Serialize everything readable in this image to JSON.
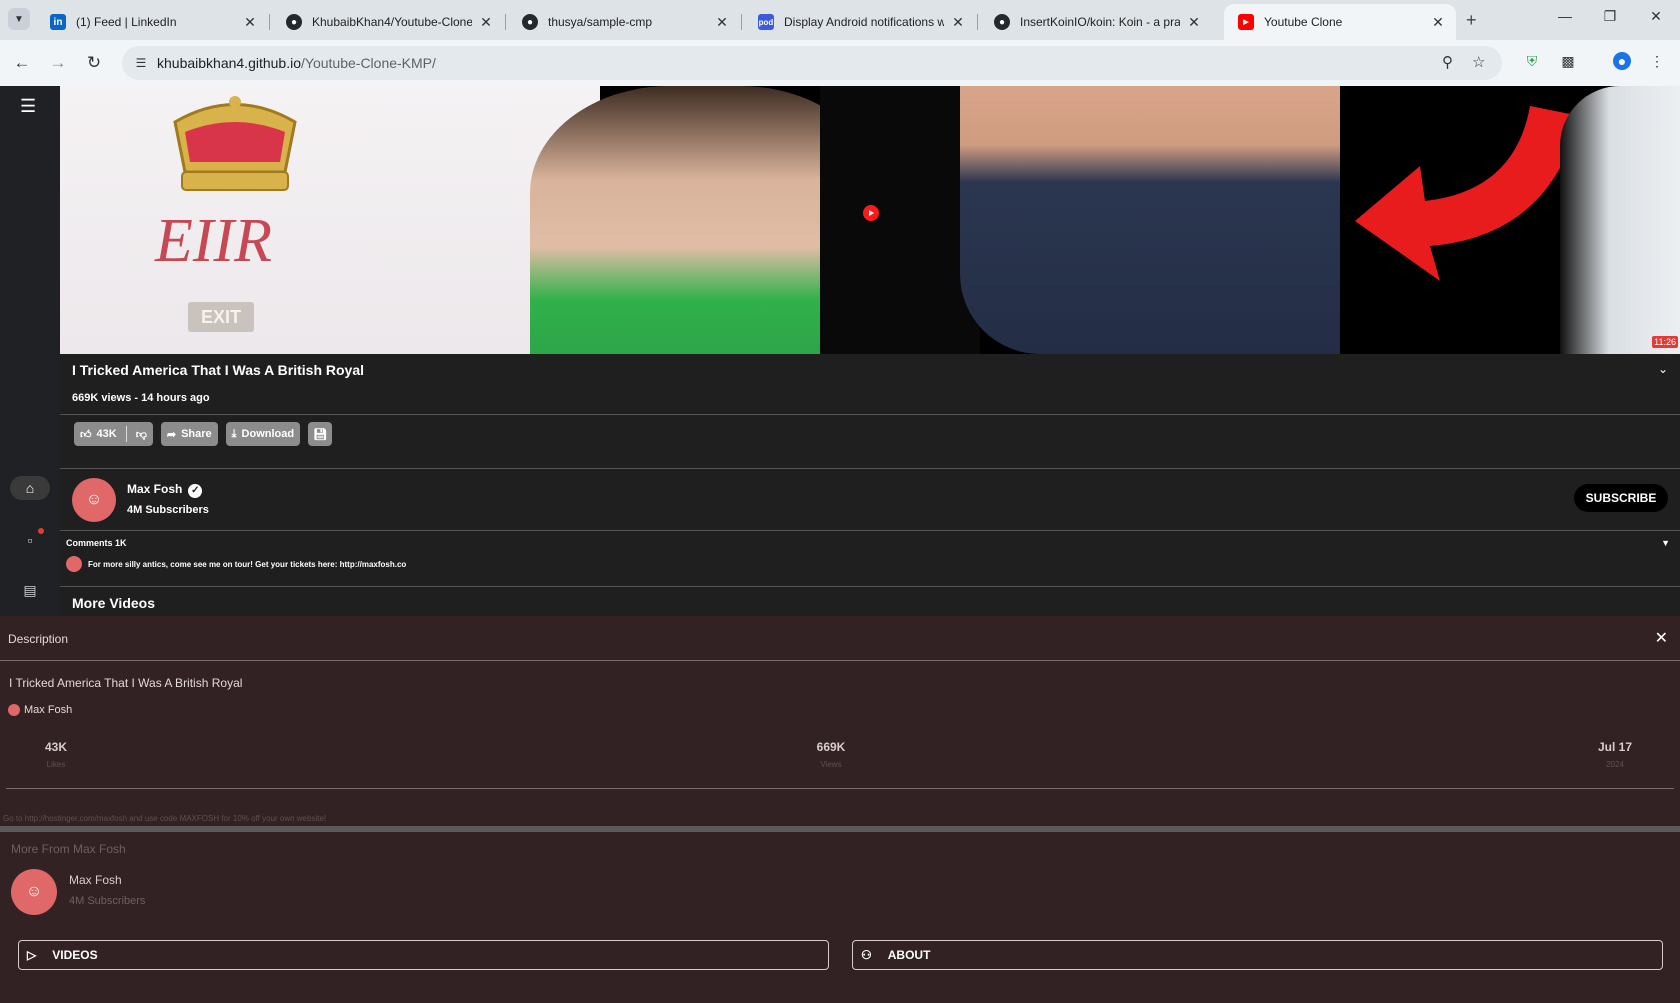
{
  "browser": {
    "tabs": [
      {
        "title": "(1) Feed | LinkedIn",
        "icon": "linkedin-icon",
        "active": false
      },
      {
        "title": "KhubaibKhan4/Youtube-Clone-",
        "icon": "github-icon",
        "active": false
      },
      {
        "title": "thusya/sample-cmp",
        "icon": "github-icon",
        "active": false
      },
      {
        "title": "Display Android notifications w",
        "icon": "pod-icon",
        "active": false
      },
      {
        "title": "InsertKoinIO/koin: Koin - a prag",
        "icon": "github-icon",
        "active": false
      },
      {
        "title": "Youtube Clone",
        "icon": "youtube-icon",
        "active": true
      }
    ],
    "url_host": "khubaibkhan4.github.io",
    "url_path": "/Youtube-Clone-KMP/"
  },
  "thumbnail": {
    "cipher_text": "EIIR",
    "sign_text": "EXIT",
    "duration": "11:26"
  },
  "video": {
    "title": "I Tricked America That I Was A British Royal",
    "stats": "669K views - 14 hours ago",
    "actions": {
      "likes": "43K",
      "share": "Share",
      "download": "Download"
    }
  },
  "channel": {
    "name": "Max Fosh",
    "subscribers": "4M Subscribers",
    "subscribe_label": "SUBSCRIBE"
  },
  "comments": {
    "header": "Comments 1K",
    "top_comment": "For more silly antics, come see me on tour! Get your tickets here: http://maxfosh.co"
  },
  "more_videos_label": "More Videos",
  "description_sheet": {
    "title": "Description",
    "video_title": "I Tricked America That I Was A British Royal",
    "owner": "Max Fosh",
    "stats": [
      {
        "value": "43K",
        "label": "Likes"
      },
      {
        "value": "669K",
        "label": "Views"
      },
      {
        "value": "Jul 17",
        "label": "2024"
      }
    ],
    "description_text": "Go to http://hostinger.com/maxfosh and use code MAXFOSH for 10% off your own website!",
    "more_from": "More From Max Fosh",
    "channel_name": "Max Fosh",
    "channel_subs": "4M Subscribers",
    "videos_label": "VIDEOS",
    "about_label": "ABOUT"
  },
  "colors": {
    "accent_red": "#ff1a1a",
    "sheet_bg": "#322223",
    "page_bg": "#1f1f1f"
  }
}
